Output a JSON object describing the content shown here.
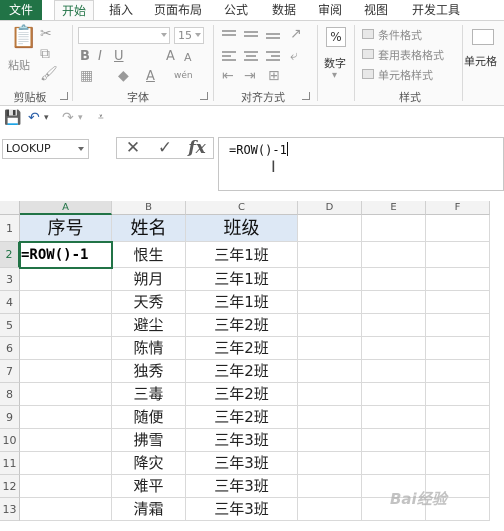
{
  "tabs": [
    "文件",
    "开始",
    "插入",
    "页面布局",
    "公式",
    "数据",
    "审阅",
    "视图",
    "开发工具"
  ],
  "ribbon": {
    "clipboard": {
      "label": "剪贴板",
      "paste": "粘贴"
    },
    "font": {
      "label": "字体",
      "size": "15",
      "bold": "B",
      "italic": "I",
      "underline": "U",
      "grow": "A",
      "shrink": "A",
      "color_a": "A",
      "wen": "wén"
    },
    "alignment": {
      "label": "对齐方式"
    },
    "number": {
      "label": "数字",
      "symbol": "%"
    },
    "styles": {
      "label": "样式",
      "cond_format": "条件格式",
      "table_format": "套用表格格式",
      "cell_styles": "单元格样式"
    },
    "cells": {
      "label": "单元格"
    }
  },
  "name_box": "LOOKUP",
  "formula_bar": {
    "cancel": "✕",
    "enter": "✓",
    "fx": "fx",
    "value": "=ROW()-1"
  },
  "columns": [
    "A",
    "B",
    "C",
    "D",
    "E",
    "F"
  ],
  "rows": [
    "1",
    "2",
    "3",
    "4",
    "5",
    "6",
    "7",
    "8",
    "9",
    "10",
    "11",
    "12",
    "13"
  ],
  "headers": {
    "a": "序号",
    "b": "姓名",
    "c": "班级"
  },
  "editing_cell": "=ROW()-1",
  "data_rows": [
    {
      "name": "恨生",
      "class": "三年1班"
    },
    {
      "name": "朔月",
      "class": "三年1班"
    },
    {
      "name": "天秀",
      "class": "三年1班"
    },
    {
      "name": "避尘",
      "class": "三年2班"
    },
    {
      "name": "陈情",
      "class": "三年2班"
    },
    {
      "name": "独秀",
      "class": "三年2班"
    },
    {
      "name": "三毒",
      "class": "三年2班"
    },
    {
      "name": "随便",
      "class": "三年2班"
    },
    {
      "name": "拂雪",
      "class": "三年3班"
    },
    {
      "name": "降灾",
      "class": "三年3班"
    },
    {
      "name": "难平",
      "class": "三年3班"
    },
    {
      "name": "清霜",
      "class": "三年3班"
    }
  ],
  "watermark": "Bai经验",
  "colors": {
    "excel_green": "#217346",
    "header_fill": "#dde8f5"
  }
}
